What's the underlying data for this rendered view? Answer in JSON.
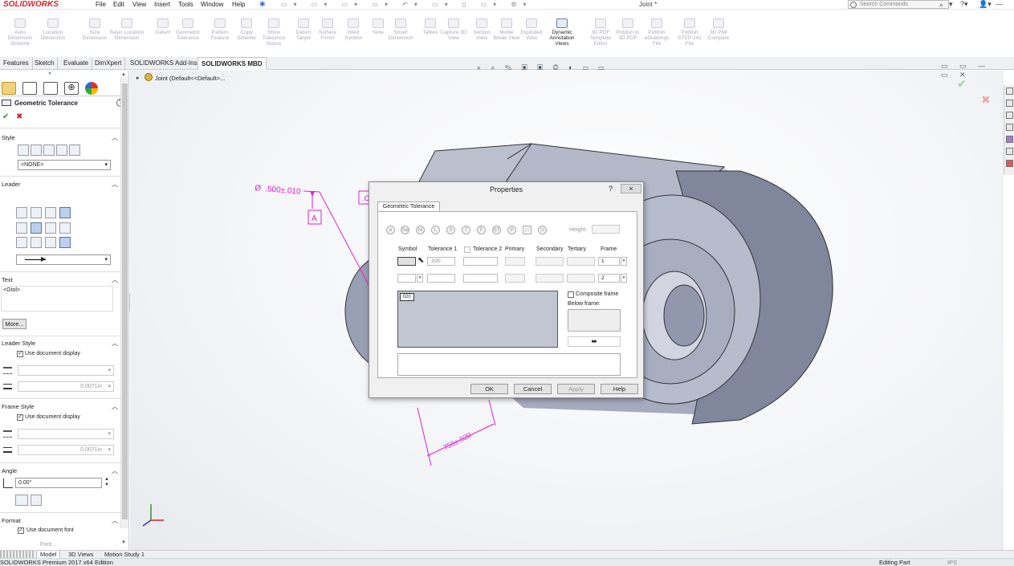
{
  "app": {
    "logo": "SOLIDWORKS",
    "doc_title": "Joint *"
  },
  "menu": [
    "File",
    "Edit",
    "View",
    "Insert",
    "Tools",
    "Window",
    "Help"
  ],
  "search": {
    "placeholder": "Search Commands"
  },
  "ribbon": [
    {
      "label": "Auto Dimension Scheme",
      "enabled": false
    },
    {
      "label": "Location Dimension",
      "enabled": false
    },
    {
      "label": "Size Dimension",
      "enabled": false
    },
    {
      "label": "Basic Location Dimension",
      "enabled": false
    },
    {
      "label": "Datum",
      "enabled": false
    },
    {
      "label": "Geometric Tolerance",
      "enabled": false
    },
    {
      "label": "Pattern Feature",
      "enabled": false
    },
    {
      "label": "Copy Scheme",
      "enabled": false
    },
    {
      "label": "Show Tolerance Status",
      "enabled": false
    },
    {
      "label": "Datum Target",
      "enabled": false
    },
    {
      "label": "Surface Finish",
      "enabled": false
    },
    {
      "label": "Weld Symbol",
      "enabled": false
    },
    {
      "label": "Note",
      "enabled": false
    },
    {
      "label": "Smart Dimension",
      "enabled": false
    },
    {
      "label": "Tables",
      "enabled": false
    },
    {
      "label": "Capture 3D View",
      "enabled": false
    },
    {
      "label": "Section View",
      "enabled": false
    },
    {
      "label": "Model Break View",
      "enabled": false
    },
    {
      "label": "Exploded View",
      "enabled": false
    },
    {
      "label": "Dynamic Annotation Views",
      "enabled": true
    },
    {
      "label": "3D PDF Template Editor",
      "enabled": false
    },
    {
      "label": "Publish to 3D PDF",
      "enabled": false
    },
    {
      "label": "Publish eDrawings File",
      "enabled": false
    },
    {
      "label": "Publish STEP 242 File",
      "enabled": false
    },
    {
      "label": "3D PMI Compare",
      "enabled": false
    }
  ],
  "cmd_tabs": [
    "Features",
    "Sketch",
    "Evaluate",
    "DimXpert",
    "SOLIDWORKS Add-Ins",
    "SOLIDWORKS MBD"
  ],
  "active_cmd_tab": "SOLIDWORKS MBD",
  "tree": {
    "root": "Joint (Default<<Default>..."
  },
  "panel": {
    "title": "Geometric Tolerance",
    "style": {
      "header": "Style",
      "select": "<NONE>"
    },
    "leader": {
      "header": "Leader"
    },
    "text": {
      "header": "Text",
      "value": "<Gtol>",
      "more": "More..."
    },
    "leader_style": {
      "header": "Leader Style",
      "use_doc": "Use document display",
      "width": "0.0071in"
    },
    "frame_style": {
      "header": "Frame Style",
      "use_doc": "Use document display",
      "width": "0.0071in"
    },
    "angle": {
      "header": "Angle",
      "value": "0.00°"
    },
    "format": {
      "header": "Format",
      "use_doc_font": "Use document font",
      "font_btn": "Font..."
    }
  },
  "annotations": {
    "dim_top": ".500±.010",
    "datum": "A",
    "dim_bottom": ".750±.020",
    "partial": ".C"
  },
  "dialog": {
    "title": "Properties",
    "help": "?",
    "close": "×",
    "tab": "Geometric Tolerance",
    "height_label": "Height:",
    "col_headers": [
      "Symbol",
      "Tolerance 1",
      "Tolerance 2",
      "Primary",
      "Secondary",
      "Tertiary",
      "Frame"
    ],
    "row1": {
      "tol1": ".020",
      "frame": "1"
    },
    "row2": {
      "frame": "2"
    },
    "preview_text": ".020",
    "composite_label": "Composite frame",
    "below_label": "Below frame:",
    "buttons": [
      "OK",
      "Cancel",
      "Apply",
      "Help"
    ]
  },
  "bottom_tabs": [
    "Model",
    "3D Views",
    "Motion Study 1"
  ],
  "active_bottom_tab": "Model",
  "status": {
    "left": "SOLIDWORKS Premium 2017 x64 Edition",
    "mode": "Editing Part",
    "units": "IPS"
  },
  "colors": {
    "accent_magenta": "#e020d8",
    "logo_red": "#d8252e",
    "part_gray": "#9aa0b6"
  }
}
